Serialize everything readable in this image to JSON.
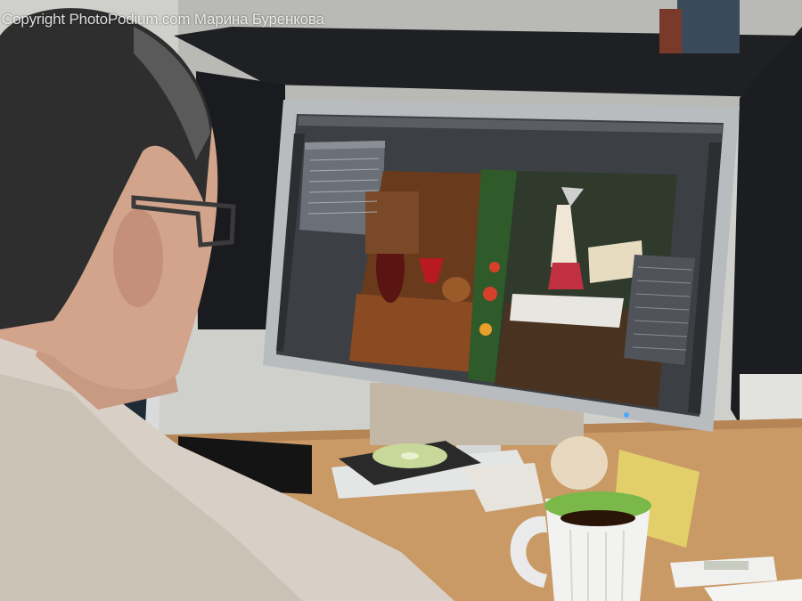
{
  "watermark": "Copyright PhotoPodium.com Марина Буренкова",
  "scene": {
    "subject": "person-at-monitor-editing-photo",
    "colors": {
      "wall": "#cfd0cc",
      "desk": "#c99a66",
      "sweater": "#d8d0c6",
      "monitor_bezel": "#b9bcbf",
      "screen_bg": "#4a4d52",
      "mug": "#f2f2f0",
      "mug_inner": "#7ab84a"
    }
  }
}
